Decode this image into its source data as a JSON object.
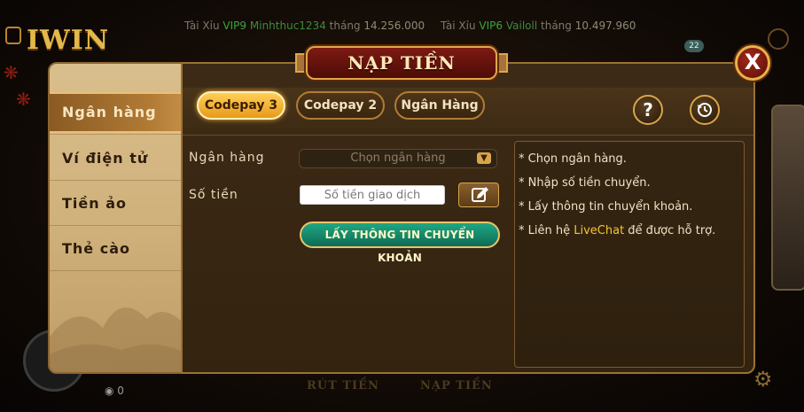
{
  "background": {
    "logo": "IWIN",
    "tickers": [
      {
        "game": "Tài Xỉu",
        "vip": "VIP9",
        "name": "Minhthuc1234",
        "period": "tháng",
        "amount": "14.256.000"
      },
      {
        "game": "Tài Xỉu",
        "vip": "VIP6",
        "name": "Vailoll",
        "period": "tháng",
        "amount": "10.497.960"
      }
    ],
    "badge": "22",
    "coins": "0",
    "bottom_labels": [
      "RÚT TIỀN",
      "NẠP TIỀN"
    ]
  },
  "dialog": {
    "title": "NẠP TIỀN",
    "close_label": "X",
    "sidebar": [
      {
        "label": "Ngân hàng",
        "active": true
      },
      {
        "label": "Ví điện tử",
        "active": false
      },
      {
        "label": "Tiền ảo",
        "active": false
      },
      {
        "label": "Thẻ cào",
        "active": false
      }
    ],
    "tabs": [
      {
        "label": "Codepay 3",
        "active": true
      },
      {
        "label": "Codepay 2",
        "active": false
      },
      {
        "label": "Ngân Hàng",
        "active": false
      }
    ],
    "help_label": "?",
    "form": {
      "bank_label": "Ngân hàng",
      "bank_placeholder": "Chọn ngân hàng",
      "amount_label": "Số tiền",
      "amount_placeholder": "Số tiền giao dịch",
      "submit_label": "LẤY THÔNG TIN CHUYỂN KHOẢN"
    },
    "instructions": [
      {
        "prefix": "* Chọn ngân hàng.",
        "highlight": "",
        "suffix": ""
      },
      {
        "prefix": "* Nhập số tiền chuyển.",
        "highlight": "",
        "suffix": ""
      },
      {
        "prefix": "* Lấy thông tin chuyển khoản.",
        "highlight": "",
        "suffix": ""
      },
      {
        "prefix": "* Liên hệ ",
        "highlight": "LiveChat",
        "suffix": " để được hỗ trợ."
      }
    ],
    "colors": {
      "accent": "#f3b43a",
      "highlight": "#f3c733",
      "cta": "#0d6b54",
      "banner": "#7d1a12"
    }
  }
}
